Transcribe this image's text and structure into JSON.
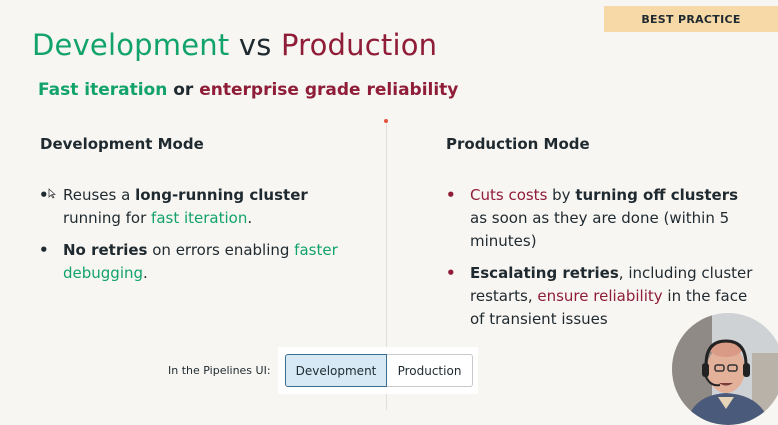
{
  "badge": "BEST PRACTICE",
  "title": {
    "part1": "Development",
    "part2": " vs ",
    "part3": "Production"
  },
  "subtitle": {
    "part1": "Fast iteration",
    "part2": " or ",
    "part3": "enterprise grade reliability"
  },
  "dev": {
    "heading": "Development Mode",
    "bullet1": {
      "a": "Reuses a ",
      "b": "long-running cluster",
      "c": " running for ",
      "d": "fast iteration",
      "e": "."
    },
    "bullet2": {
      "a": "No retries",
      "b": " on errors enabling ",
      "c": "faster debugging",
      "d": "."
    }
  },
  "prod": {
    "heading": "Production Mode",
    "bullet1": {
      "a": "Cuts costs",
      "b": " by ",
      "c": "turning off clusters",
      "d": " as soon as they are done (within 5 minutes)"
    },
    "bullet2": {
      "a": "Escalating retries",
      "b": ", including cluster restarts, ",
      "c": "ensure reliability",
      "d": " in the face of transient issues"
    }
  },
  "pipelines": {
    "label": "In the Pipelines UI:",
    "options": [
      "Development",
      "Production"
    ],
    "selected": "Development"
  },
  "colors": {
    "green": "#12a36a",
    "red": "#8f1d38",
    "badge_bg": "#f7d9a8",
    "background": "#f8f6f2",
    "toggle_active_bg": "#d7e9f5",
    "toggle_active_border": "#3b6f92"
  },
  "icons": {
    "cursor": "mouse-cursor-icon",
    "webcam": "presenter-webcam"
  }
}
